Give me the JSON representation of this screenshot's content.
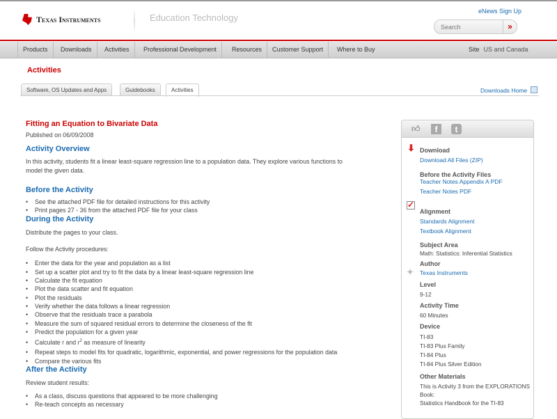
{
  "header": {
    "brand": "Texas Instruments",
    "section": "Education Technology",
    "enews": "eNews Sign Up",
    "search_placeholder": "Search",
    "search_go": "»"
  },
  "nav": {
    "items": [
      "Products",
      "Downloads",
      "Activities",
      "Professional Development",
      "Resources",
      "Customer Support",
      "Where to Buy"
    ],
    "site_label": "Site",
    "site_value": "US and Canada"
  },
  "page_title": "Activities",
  "tabs": [
    "Software, OS Updates and Apps",
    "Guidebooks",
    "Activities"
  ],
  "downloads_home": "Downloads Home",
  "main": {
    "title": "Fitting an Equation to Bivariate Data",
    "published": "Published on 06/09/2008",
    "overview_h": "Activity Overview",
    "overview_p1": "In this activity, students fit a linear least-square regression line to a population data. They explore various functions to",
    "overview_p2": "model the given data.",
    "before_h": "Before the Activity",
    "before": [
      "See the attached PDF file for detailed instructions for this activity",
      "Print pages 27 - 36 from the attached PDF file for your class"
    ],
    "during_h": "During the Activity",
    "during_p1": "Distribute the pages to your class.",
    "during_p2": "Follow the Activity procedures:",
    "during": [
      "Enter the data for the year and population as a list",
      "Set up a scatter plot and try to fit the data by a linear least-square regression line",
      "Calculate the fit equation",
      "Plot the data scatter and fit equation",
      "Plot the residuals",
      "Verify whether the data follows a linear regression",
      "Observe that the residuals trace a parabola",
      "Measure the sum of squared residual errors to determine the closeness of the fit",
      "Predict the population for a given year"
    ],
    "r2_pre": "Calculate r and r",
    "r2_sup": "2",
    "r2_post": " as measure of linearity",
    "during2": [
      "Repeat steps to model fits for quadratic, logarithmic, exponential, and power regressions for the population data",
      "Compare the various fits"
    ],
    "after_h": "After the Activity",
    "after_p": "Review student results:",
    "after": [
      "As a class, discuss questions that appeared to be more challenging",
      "Re-teach concepts as necessary"
    ]
  },
  "side": {
    "download_h": "Download",
    "download_all": "Download All Files (ZIP)",
    "before_files_h": "Before the Activity Files",
    "before_files": [
      "Teacher Notes Appendix A PDF",
      "Teacher Notes PDF"
    ],
    "alignment_h": "Alignment",
    "alignment": [
      "Standards Alignment",
      "Textbook Alignment"
    ],
    "subject_h": "Subject Area",
    "subject": "Math: Statistics: Inferential Statistics",
    "author_h": "Author",
    "author": "Texas Instruments",
    "level_h": "Level",
    "level": "9-12",
    "time_h": "Activity Time",
    "time": "60 Minutes",
    "device_h": "Device",
    "devices": [
      "TI-83",
      "TI-83 Plus Family",
      "TI-84 Plus",
      "TI-84 Plus Silver Edition"
    ],
    "other_h": "Other Materials",
    "other": [
      "This is Activity 3 from the EXPLORATIONS",
      "Book:",
      "Statistics Handbook for the TI-83"
    ]
  }
}
